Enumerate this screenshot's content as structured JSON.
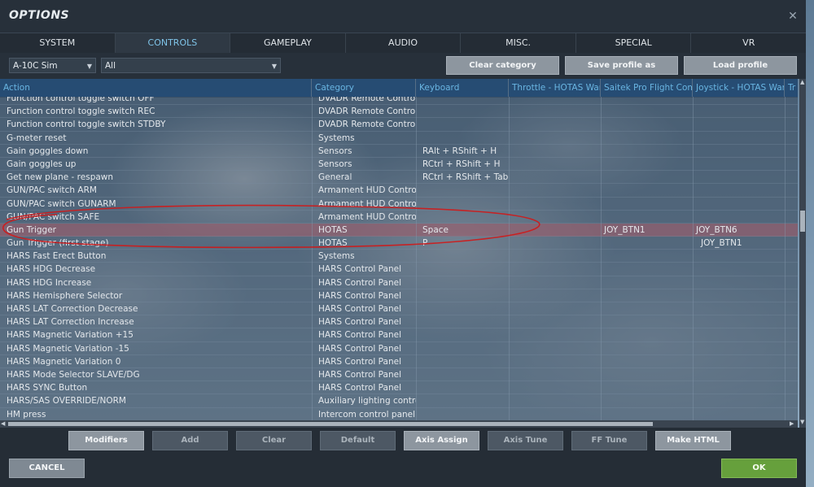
{
  "window": {
    "title": "OPTIONS",
    "close_glyph": "✕"
  },
  "tabs": [
    {
      "label": "SYSTEM",
      "active": false
    },
    {
      "label": "CONTROLS",
      "active": true
    },
    {
      "label": "GAMEPLAY",
      "active": false
    },
    {
      "label": "AUDIO",
      "active": false
    },
    {
      "label": "MISC.",
      "active": false
    },
    {
      "label": "SPECIAL",
      "active": false
    },
    {
      "label": "VR",
      "active": false
    }
  ],
  "toolbar": {
    "aircraft": "A-10C Sim",
    "category_filter": "All",
    "clear_category": "Clear category",
    "save_profile": "Save profile as",
    "load_profile": "Load profile"
  },
  "columns": [
    "Action",
    "Category",
    "Keyboard",
    "Throttle - HOTAS Wart",
    "Saitek Pro Flight Comb",
    "Joystick - HOTAS Warth",
    "Tr"
  ],
  "rows": [
    {
      "action": "Function control toggle switch OFF",
      "category": "DVADR Remote Control Pa",
      "keyboard": "",
      "throttle": "",
      "saitek": "",
      "joystick": ""
    },
    {
      "action": "Function control toggle switch REC",
      "category": "DVADR Remote Control Pa",
      "keyboard": "",
      "throttle": "",
      "saitek": "",
      "joystick": ""
    },
    {
      "action": "Function control toggle switch STDBY",
      "category": "DVADR Remote Control Pa",
      "keyboard": "",
      "throttle": "",
      "saitek": "",
      "joystick": ""
    },
    {
      "action": "G-meter reset",
      "category": "Systems",
      "keyboard": "",
      "throttle": "",
      "saitek": "",
      "joystick": ""
    },
    {
      "action": "Gain goggles down",
      "category": "Sensors",
      "keyboard": "RAlt + RShift + H",
      "throttle": "",
      "saitek": "",
      "joystick": ""
    },
    {
      "action": "Gain goggles up",
      "category": "Sensors",
      "keyboard": "RCtrl + RShift + H",
      "throttle": "",
      "saitek": "",
      "joystick": ""
    },
    {
      "action": "Get new plane - respawn",
      "category": "General",
      "keyboard": "RCtrl + RShift + Tab",
      "throttle": "",
      "saitek": "",
      "joystick": ""
    },
    {
      "action": "GUN/PAC switch ARM",
      "category": "Armament HUD Control P",
      "keyboard": "",
      "throttle": "",
      "saitek": "",
      "joystick": ""
    },
    {
      "action": "GUN/PAC switch GUNARM",
      "category": "Armament HUD Control P",
      "keyboard": "",
      "throttle": "",
      "saitek": "",
      "joystick": ""
    },
    {
      "action": "GUN/PAC switch SAFE",
      "category": "Armament HUD Control P",
      "keyboard": "",
      "throttle": "",
      "saitek": "",
      "joystick": ""
    },
    {
      "action": "Gun Trigger",
      "category": "HOTAS",
      "keyboard": "Space",
      "throttle": "",
      "saitek": "JOY_BTN1",
      "joystick": "JOY_BTN6",
      "selected": true
    },
    {
      "action": "Gun Trigger (first stage)",
      "category": "HOTAS",
      "keyboard": "P",
      "throttle": "",
      "saitek": "",
      "joystick": "JOY_BTN1"
    },
    {
      "action": "HARS Fast Erect Button",
      "category": "Systems",
      "keyboard": "",
      "throttle": "",
      "saitek": "",
      "joystick": ""
    },
    {
      "action": "HARS HDG Decrease",
      "category": "HARS Control Panel",
      "keyboard": "",
      "throttle": "",
      "saitek": "",
      "joystick": ""
    },
    {
      "action": "HARS HDG Increase",
      "category": "HARS Control Panel",
      "keyboard": "",
      "throttle": "",
      "saitek": "",
      "joystick": ""
    },
    {
      "action": "HARS Hemisphere Selector",
      "category": "HARS Control Panel",
      "keyboard": "",
      "throttle": "",
      "saitek": "",
      "joystick": ""
    },
    {
      "action": "HARS LAT Correction Decrease",
      "category": "HARS Control Panel",
      "keyboard": "",
      "throttle": "",
      "saitek": "",
      "joystick": ""
    },
    {
      "action": "HARS LAT Correction Increase",
      "category": "HARS Control Panel",
      "keyboard": "",
      "throttle": "",
      "saitek": "",
      "joystick": ""
    },
    {
      "action": "HARS Magnetic Variation +15",
      "category": "HARS Control Panel",
      "keyboard": "",
      "throttle": "",
      "saitek": "",
      "joystick": ""
    },
    {
      "action": "HARS Magnetic Variation -15",
      "category": "HARS Control Panel",
      "keyboard": "",
      "throttle": "",
      "saitek": "",
      "joystick": ""
    },
    {
      "action": "HARS Magnetic Variation 0",
      "category": "HARS Control Panel",
      "keyboard": "",
      "throttle": "",
      "saitek": "",
      "joystick": ""
    },
    {
      "action": "HARS Mode Selector SLAVE/DG",
      "category": "HARS Control Panel",
      "keyboard": "",
      "throttle": "",
      "saitek": "",
      "joystick": ""
    },
    {
      "action": "HARS SYNC Button",
      "category": "HARS Control Panel",
      "keyboard": "",
      "throttle": "",
      "saitek": "",
      "joystick": ""
    },
    {
      "action": "HARS/SAS OVERRIDE/NORM",
      "category": "Auxiliary lighting control p",
      "keyboard": "",
      "throttle": "",
      "saitek": "",
      "joystick": ""
    },
    {
      "action": "HM press",
      "category": "Intercom control panel",
      "keyboard": "",
      "throttle": "",
      "saitek": "",
      "joystick": ""
    }
  ],
  "bottom_buttons": [
    {
      "label": "Modifiers",
      "enabled": true
    },
    {
      "label": "Add",
      "enabled": false
    },
    {
      "label": "Clear",
      "enabled": false
    },
    {
      "label": "Default",
      "enabled": false
    },
    {
      "label": "Axis Assign",
      "enabled": true
    },
    {
      "label": "Axis Tune",
      "enabled": false
    },
    {
      "label": "FF Tune",
      "enabled": false
    },
    {
      "label": "Make HTML",
      "enabled": true
    }
  ],
  "footer": {
    "cancel": "CANCEL",
    "ok": "OK"
  },
  "colors": {
    "active_tab_text": "#7fc4e8",
    "header_text": "#69b5e2",
    "ok_green": "#66a03c",
    "annotation_red": "#d01818",
    "selected_row": "#965f6e"
  },
  "icons": {
    "dropdown": "chevron-down-icon",
    "close": "close-icon"
  }
}
